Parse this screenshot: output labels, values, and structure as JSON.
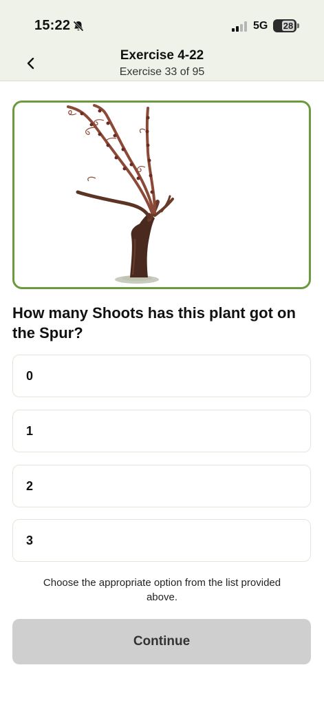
{
  "status_bar": {
    "time": "15:22",
    "network": "5G",
    "battery": "28",
    "icons": [
      "bell-muted-icon",
      "signal-icon",
      "battery-icon"
    ]
  },
  "header": {
    "title": "Exercise 4-22",
    "subtitle": "Exercise 33 of 95",
    "back_icon": "chevron-left-icon"
  },
  "illustration": {
    "alt": "grapevine-plant-illustration",
    "border_color": "#6a9a3c"
  },
  "question": "How many Shoots has this plant got on the Spur?",
  "options": [
    {
      "label": "0"
    },
    {
      "label": "1"
    },
    {
      "label": "2"
    },
    {
      "label": "3"
    }
  ],
  "hint": "Choose the appropriate option from the list provided above.",
  "continue_label": "Continue",
  "colors": {
    "header_bg": "#eef2e8",
    "accent": "#6a9a3c",
    "button_disabled": "#cfcfcf"
  }
}
